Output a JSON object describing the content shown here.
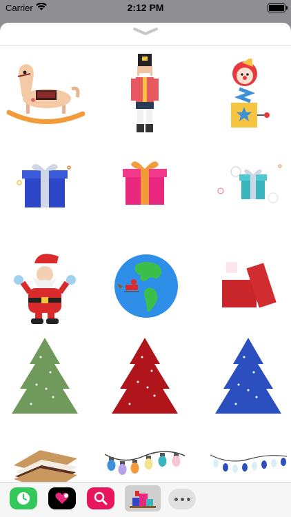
{
  "status_bar": {
    "carrier": "Carrier",
    "time": "2:12 PM",
    "wifi_icon": "wifi-icon",
    "battery_icon": "battery-icon"
  },
  "sheet": {
    "grabber_icon": "chevron-down-icon"
  },
  "stickers": [
    {
      "name": "rocking-horse"
    },
    {
      "name": "nutcracker"
    },
    {
      "name": "jack-in-the-box"
    },
    {
      "name": "blue-gift"
    },
    {
      "name": "pink-gift"
    },
    {
      "name": "teal-gift"
    },
    {
      "name": "santa-claus"
    },
    {
      "name": "earth-santa-sleigh"
    },
    {
      "name": "red-boxes"
    },
    {
      "name": "green-tree"
    },
    {
      "name": "red-tree"
    },
    {
      "name": "blue-tree"
    },
    {
      "name": "smore"
    },
    {
      "name": "colorful-lights"
    },
    {
      "name": "blue-lights"
    }
  ],
  "app_tray": {
    "apps": [
      {
        "name": "clock-app-icon",
        "color": "#34c759"
      },
      {
        "name": "heart-app-icon",
        "color": "#000000"
      },
      {
        "name": "search-app-icon",
        "color": "#e8175d"
      },
      {
        "name": "christmas-sticker-app-icon",
        "color": "#cfcfcf"
      }
    ],
    "more_icon": "more-icon"
  }
}
